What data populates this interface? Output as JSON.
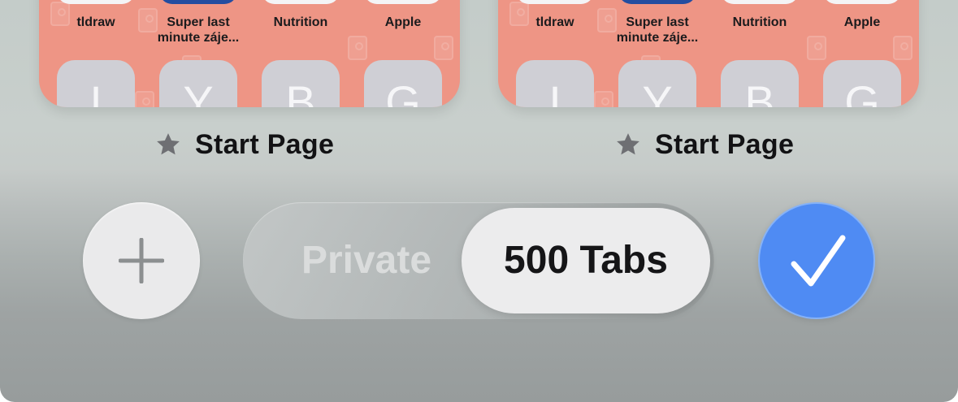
{
  "tab_grid": {
    "cards": [
      {
        "title": "Start Page",
        "favorites": [
          "tldraw",
          "Super last minute záje...",
          "Nutrition",
          "Apple"
        ],
        "frequent": [
          "I",
          "Y",
          "B",
          "G"
        ]
      },
      {
        "title": "Start Page",
        "favorites": [
          "tldraw",
          "Super last minute záje...",
          "Nutrition",
          "Apple"
        ],
        "frequent": [
          "I",
          "Y",
          "B",
          "G"
        ]
      }
    ]
  },
  "toolbar": {
    "segment_private_label": "Private",
    "segment_tabs_label": "500 Tabs",
    "selected_segment": "500 Tabs",
    "new_tab_icon": "plus-icon",
    "done_icon": "checkmark-icon"
  },
  "colors": {
    "wallpaper": "#ee9585",
    "done_button": "#4f8bf3",
    "letter_tile": "#cfcfd5"
  }
}
